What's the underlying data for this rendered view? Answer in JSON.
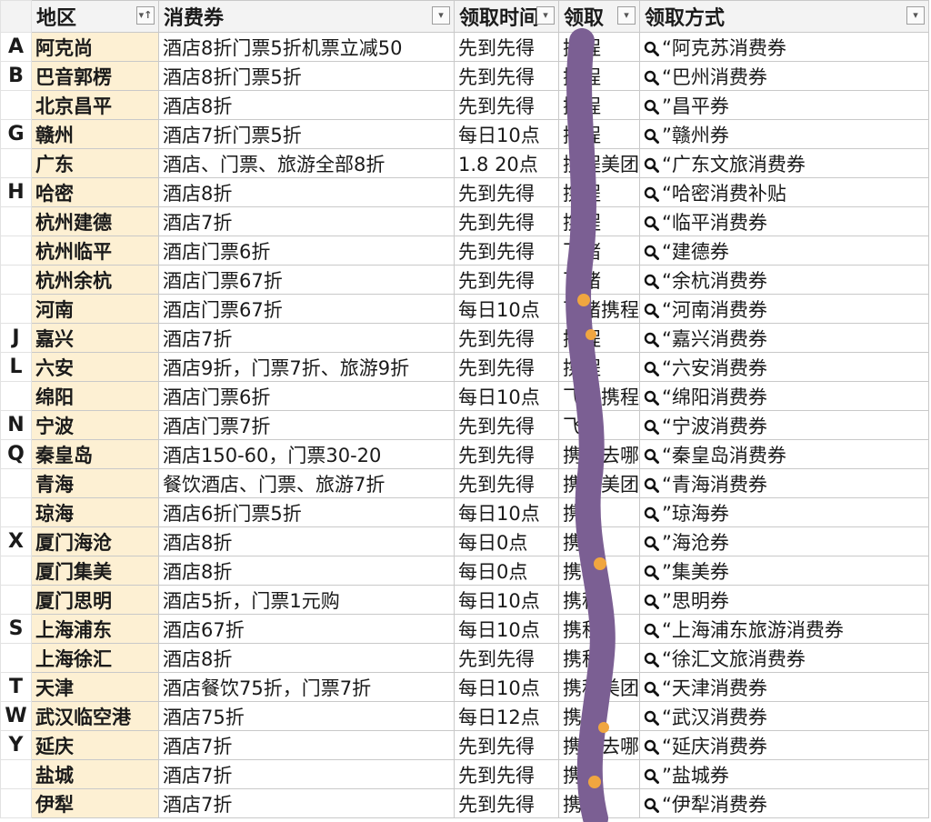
{
  "headers": {
    "region": "地区",
    "voucher": "消费券",
    "time": "领取时间",
    "get": "领取",
    "method": "领取方式",
    "region_filter_icon": "sort-filter-icon",
    "filter_icon": "filter-dropdown-icon"
  },
  "rows": [
    {
      "idx": "A",
      "region": "阿克尚",
      "voucher": "酒店8折门票5折机票立减50",
      "time": "先到先得",
      "get": "携程",
      "method": "“阿克苏消费券"
    },
    {
      "idx": "B",
      "region": "巴音郭楞",
      "voucher": "酒店8折门票5折",
      "time": "先到先得",
      "get": "携程",
      "method": "“巴州消费券"
    },
    {
      "idx": "",
      "region": "北京昌平",
      "voucher": "酒店8折",
      "time": "先到先得",
      "get": "携程",
      "method": "”昌平券"
    },
    {
      "idx": "G",
      "region": "赣州",
      "voucher": "酒店7折门票5折",
      "time": "每日10点",
      "get": "携程",
      "method": "”赣州券"
    },
    {
      "idx": "",
      "region": "广东",
      "voucher": "酒店、门票、旅游全部8折",
      "time": "1.8 20点",
      "get": "携程美团",
      "method": "“广东文旅消费券"
    },
    {
      "idx": "H",
      "region": "哈密",
      "voucher": "酒店8折",
      "time": "先到先得",
      "get": "携程",
      "method": "“哈密消费补贴"
    },
    {
      "idx": "",
      "region": "杭州建德",
      "voucher": "酒店7折",
      "time": "先到先得",
      "get": "携程",
      "method": "“临平消费券"
    },
    {
      "idx": "",
      "region": "杭州临平",
      "voucher": "酒店门票6折",
      "time": "先到先得",
      "get": "飞猪",
      "method": "“建德券"
    },
    {
      "idx": "",
      "region": "杭州余杭",
      "voucher": "酒店门票67折",
      "time": "先到先得",
      "get": "飞猪",
      "method": "“余杭消费券"
    },
    {
      "idx": "",
      "region": "河南",
      "voucher": "酒店门票67折",
      "time": "每日10点",
      "get": "飞猪携程",
      "method": "“河南消费券"
    },
    {
      "idx": "J",
      "region": "嘉兴",
      "voucher": "酒店7折",
      "time": "先到先得",
      "get": "携程",
      "method": "“嘉兴消费券"
    },
    {
      "idx": "L",
      "region": "六安",
      "voucher": "酒店9折，门票7折、旅游9折",
      "time": "先到先得",
      "get": "携程",
      "method": "“六安消费券"
    },
    {
      "idx": "",
      "region": "绵阳",
      "voucher": "酒店门票6折",
      "time": "每日10点",
      "get": "飞猪携程",
      "method": "“绵阳消费券"
    },
    {
      "idx": "N",
      "region": "宁波",
      "voucher": "酒店门票7折",
      "time": "先到先得",
      "get": "飞猪",
      "method": "“宁波消费券"
    },
    {
      "idx": "Q",
      "region": "秦皇岛",
      "voucher": "酒店150-60，门票30-20",
      "time": "先到先得",
      "get": "携程去哪",
      "method": "“秦皇岛消费券"
    },
    {
      "idx": "",
      "region": "青海",
      "voucher": "餐饮酒店、门票、旅游7折",
      "time": "先到先得",
      "get": "携程美团",
      "method": "“青海消费券"
    },
    {
      "idx": "",
      "region": "琼海",
      "voucher": "酒店6折门票5折",
      "time": "每日10点",
      "get": "携程",
      "method": "”琼海券"
    },
    {
      "idx": "X",
      "region": "厦门海沧",
      "voucher": "酒店8折",
      "time": "每日0点",
      "get": "携程",
      "method": "”海沧券"
    },
    {
      "idx": "",
      "region": "厦门集美",
      "voucher": "酒店8折",
      "time": "每日0点",
      "get": "携程",
      "method": "”集美券"
    },
    {
      "idx": "",
      "region": "厦门思明",
      "voucher": "酒店5折，门票1元购",
      "time": "每日10点",
      "get": "携程",
      "method": "”思明券"
    },
    {
      "idx": "S",
      "region": "上海浦东",
      "voucher": "酒店67折",
      "time": "每日10点",
      "get": "携程",
      "method": "“上海浦东旅游消费券"
    },
    {
      "idx": "",
      "region": "上海徐汇",
      "voucher": "酒店8折",
      "time": "先到先得",
      "get": "携程",
      "method": "“徐汇文旅消费券"
    },
    {
      "idx": "T",
      "region": "天津",
      "voucher": "酒店餐饮75折，门票7折",
      "time": "每日10点",
      "get": "携程美团",
      "method": "“天津消费券"
    },
    {
      "idx": "W",
      "region": "武汉临空港",
      "voucher": "酒店75折",
      "time": "每日12点",
      "get": "携程",
      "method": "“武汉消费券"
    },
    {
      "idx": "Y",
      "region": "延庆",
      "voucher": "酒店7折",
      "time": "先到先得",
      "get": "携程去哪",
      "method": "“延庆消费券"
    },
    {
      "idx": "",
      "region": "盐城",
      "voucher": "酒店7折",
      "time": "先到先得",
      "get": "携程",
      "method": "”盐城券"
    },
    {
      "idx": "",
      "region": "伊犁",
      "voucher": "酒店7折",
      "time": "先到先得",
      "get": "携程",
      "method": "“伊犁消费券"
    }
  ],
  "colors": {
    "region_fill": "#fdf0d3",
    "header_fill": "#f3f3f3",
    "grid": "#c9c9c9",
    "scribble": "#7b5f93"
  },
  "icons": {
    "method_prefix": "magnifier-icon"
  }
}
